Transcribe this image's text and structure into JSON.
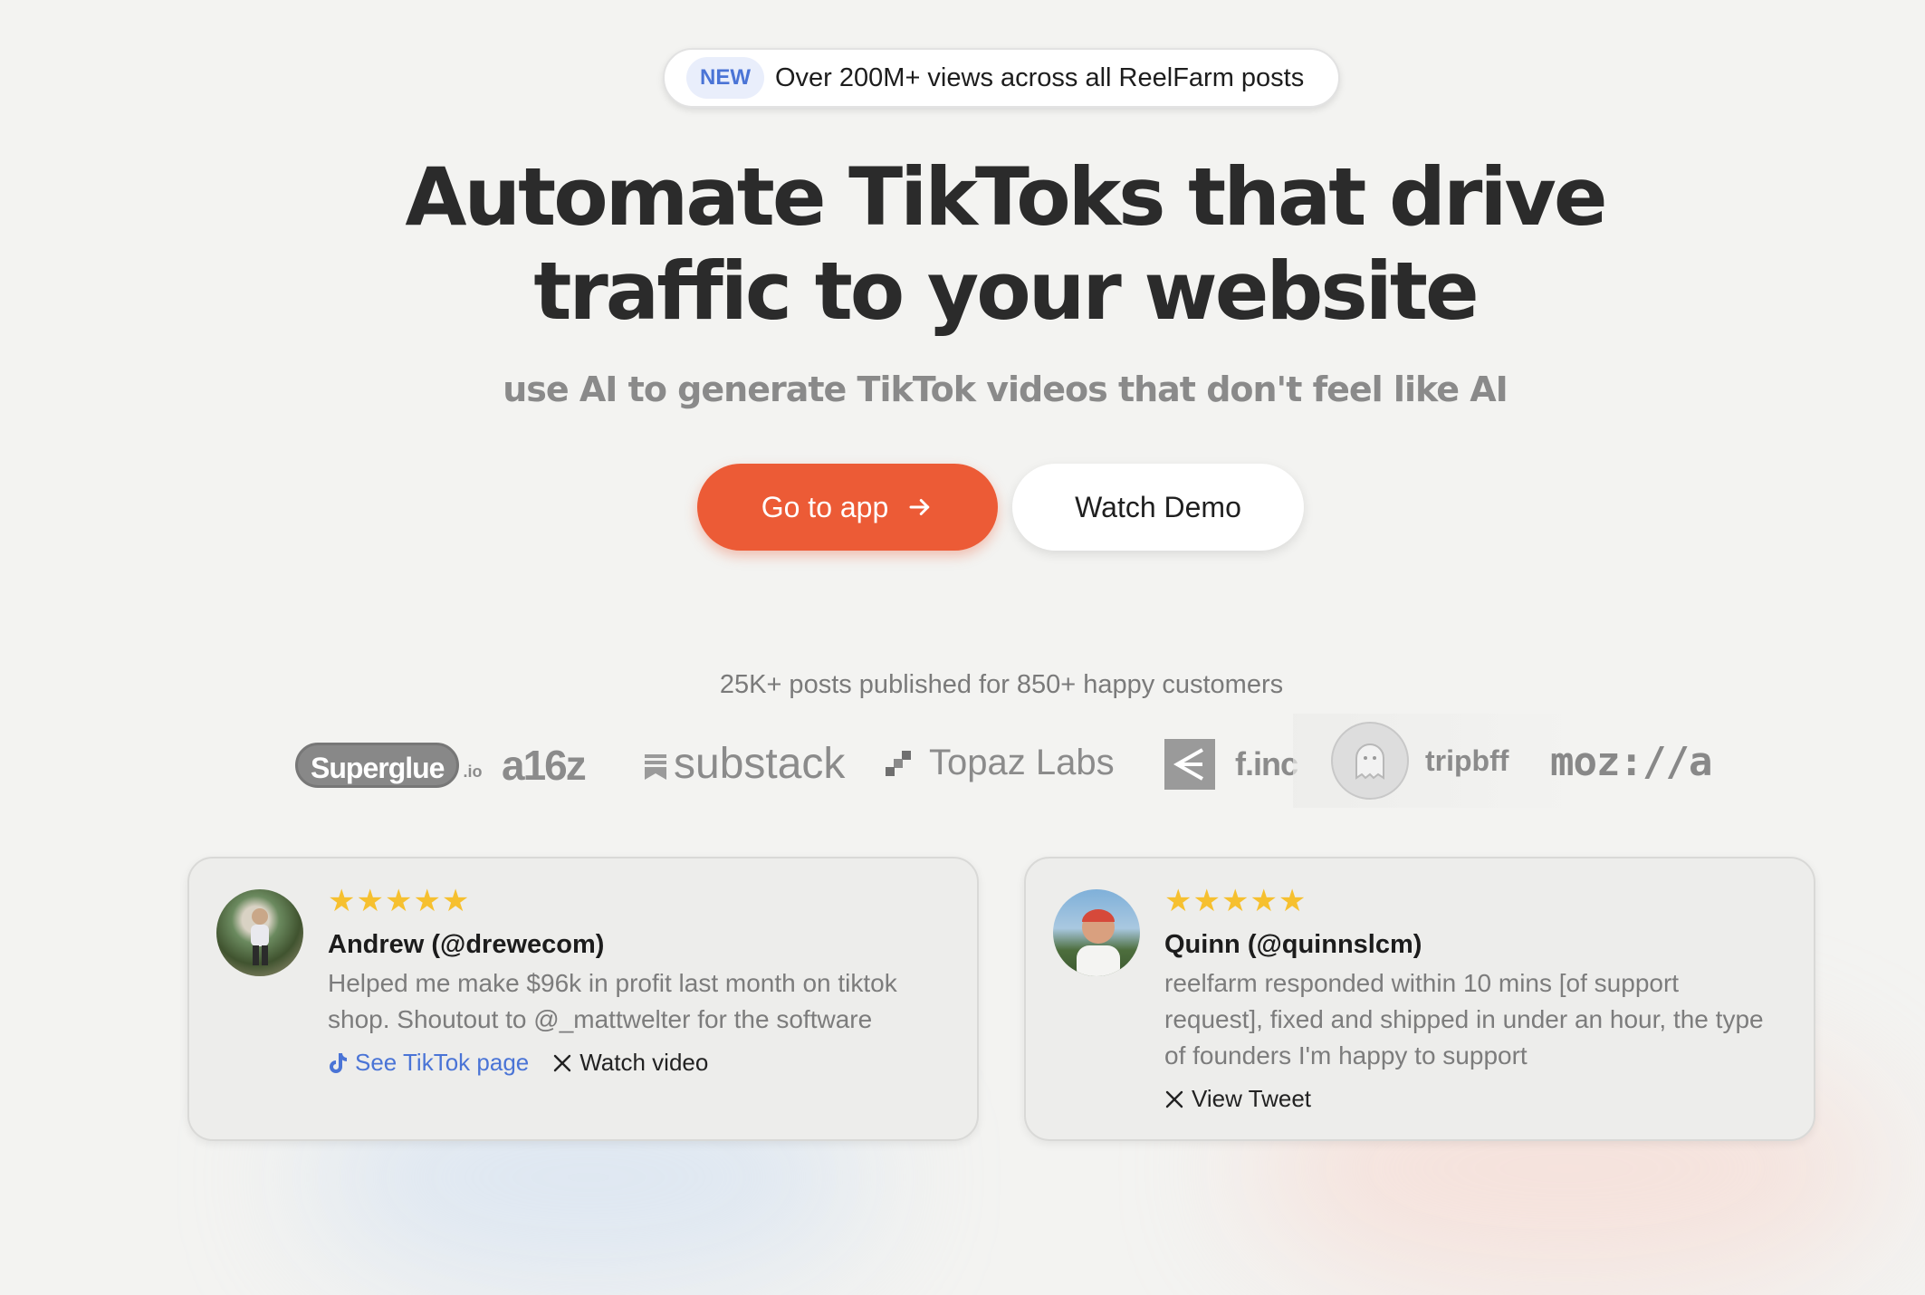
{
  "announcement": {
    "badge": "NEW",
    "text": "Over 200M+ views across all ReelFarm posts"
  },
  "hero": {
    "title_line1": "Automate TikToks that drive",
    "title_line2": "traffic to your website",
    "subtitle": "use AI to generate TikTok videos that don't feel like AI"
  },
  "buttons": {
    "primary": "Go to app",
    "secondary": "Watch Demo"
  },
  "social_proof": "25K+ posts published for 850+ happy customers",
  "logos": {
    "superglue": "Superglue",
    "superglue_suffix": ".io",
    "a16z": "a16z",
    "substack": "substack",
    "topaz": "Topaz Labs",
    "finc": "f.inc",
    "tripbff": "tripbff",
    "mozilla": "moz://a"
  },
  "testimonials": [
    {
      "stars": "★★★★★",
      "name": "Andrew (@drewecom)",
      "quote": "Helped me make $96k in profit last month on tiktok shop. Shoutout to @_mattwelter for the software",
      "link1": "See TikTok page",
      "link2": "Watch video"
    },
    {
      "stars": "★★★★★",
      "name": "Quinn (@quinnslcm)",
      "quote": "reelfarm responded within 10 mins [of support request], fixed and shipped in under an hour, the type of founders I'm happy to support",
      "link1": "View Tweet"
    }
  ],
  "colors": {
    "accent": "#ec5b36",
    "badge_text": "#4a74d6",
    "star": "#f6c02f",
    "background": "#f3f3f1"
  },
  "icons": [
    "arrow-right-icon",
    "tiktok-icon",
    "x-icon"
  ]
}
